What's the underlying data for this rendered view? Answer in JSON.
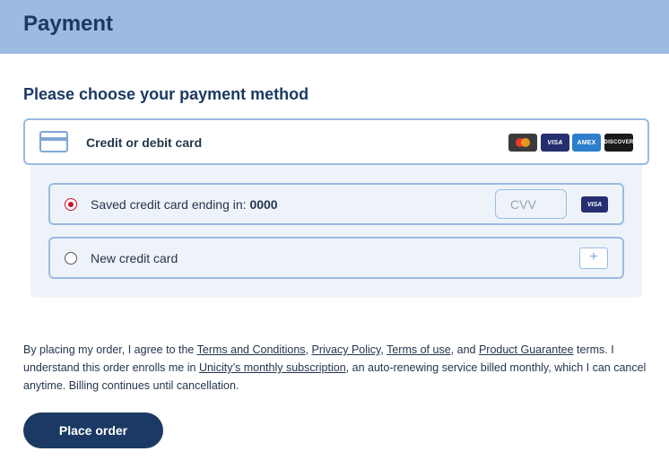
{
  "header": {
    "title": "Payment"
  },
  "section": {
    "title": "Please choose your payment method"
  },
  "method": {
    "label": "Credit or debit card",
    "brands": {
      "mastercard": "",
      "visa": "VISA",
      "amex": "AMEX",
      "discover": "DISCOVER"
    }
  },
  "saved_card": {
    "label_prefix": "Saved credit card ending in: ",
    "last4": "0000",
    "cvv_placeholder": "CVV",
    "brand": "VISA",
    "selected": true
  },
  "new_card": {
    "label": "New credit card",
    "add_symbol": "+",
    "selected": false
  },
  "terms": {
    "t1": "By placing my order, I agree to the ",
    "link_terms": "Terms and Conditions",
    "t2": ", ",
    "link_privacy": "Privacy Policy",
    "t3": ", ",
    "link_terms_use": "Terms of use",
    "t4": ", and ",
    "link_guarantee": "Product Guarantee",
    "t5": " terms. I understand this order enrolls me in ",
    "link_subscription": "Unicity’s monthly subscription",
    "t6": ", an auto-renewing service billed monthly, which I can cancel anytime. Billing continues until cancellation."
  },
  "actions": {
    "place_order": "Place order"
  },
  "colors": {
    "header_bg": "#9bbbe0",
    "primary": "#1b3a63",
    "radio_selected": "#c8102e",
    "panel_bg": "#eef3f9"
  }
}
